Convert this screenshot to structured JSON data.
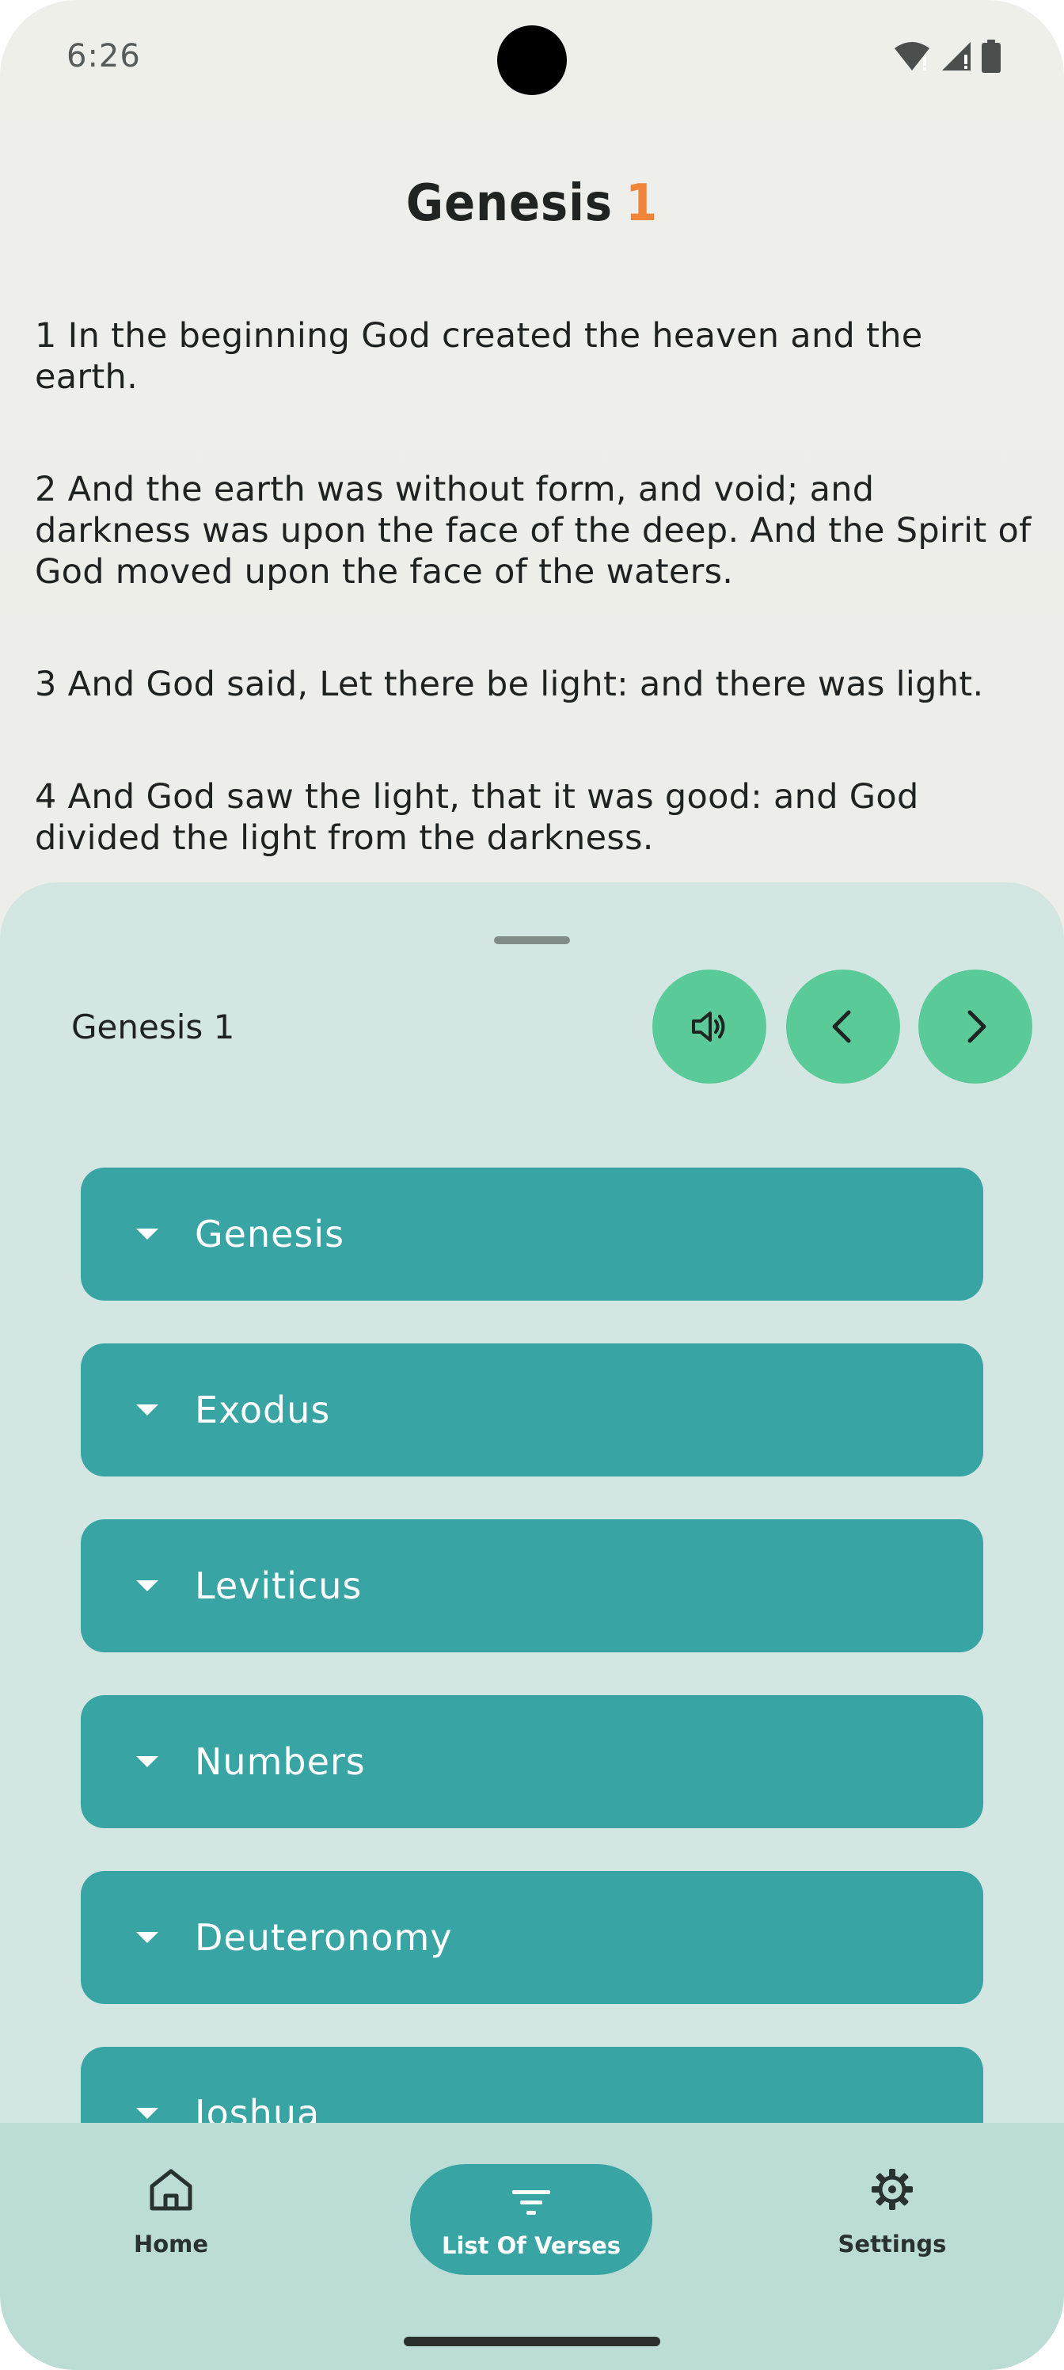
{
  "status_bar": {
    "time": "6:26"
  },
  "chapter": {
    "book": "Genesis",
    "number": "1"
  },
  "verses": [
    "1 In the beginning God created the heaven and the earth.",
    "2 And the earth was without form, and void; and darkness was upon the face of the deep. And the Spirit of God moved upon the face of the waters.",
    "3 And God said, Let there be light: and there was light.",
    "4 And God saw the light, that it was good: and God divided the light from the darkness."
  ],
  "sheet": {
    "current": "Genesis 1",
    "buttons": {
      "audio": "speaker-icon",
      "prev": "chevron-left-icon",
      "next": "chevron-right-icon"
    },
    "books": [
      "Genesis",
      "Exodus",
      "Leviticus",
      "Numbers",
      "Deuteronomy",
      "Joshua"
    ]
  },
  "nav": {
    "home": "Home",
    "verses": "List Of Verses",
    "settings": "Settings",
    "active": "verses"
  },
  "colors": {
    "accent_teal": "#39a4a4",
    "button_green": "#5acb98",
    "chapter_number": "#f0853a",
    "sheet_bg": "#d4e6e2",
    "nav_bg": "#bcdcd6"
  }
}
